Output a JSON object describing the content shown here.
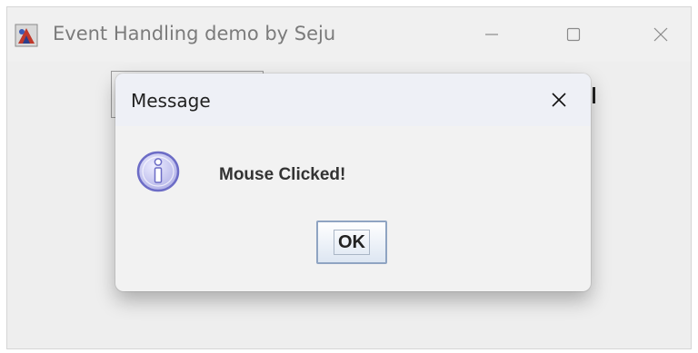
{
  "window": {
    "title": "Event Handling demo by Seju",
    "app_icon": "java-duke-icon",
    "controls": [
      "minimize-icon",
      "maximize-icon",
      "close-icon"
    ]
  },
  "dialog": {
    "title": "Message",
    "icon": "info-icon",
    "message": "Mouse Clicked!",
    "ok_label": "OK",
    "close_icon": "close-icon"
  },
  "colors": {
    "window_bg": "#eeeeee",
    "dialog_bg": "#f2f2f2",
    "dialog_titlebar_bg": "#eef0f6",
    "info_icon_fill": "#c9c9f0",
    "info_icon_stroke": "#6c6cc6",
    "button_border": "#8fa4c2"
  }
}
